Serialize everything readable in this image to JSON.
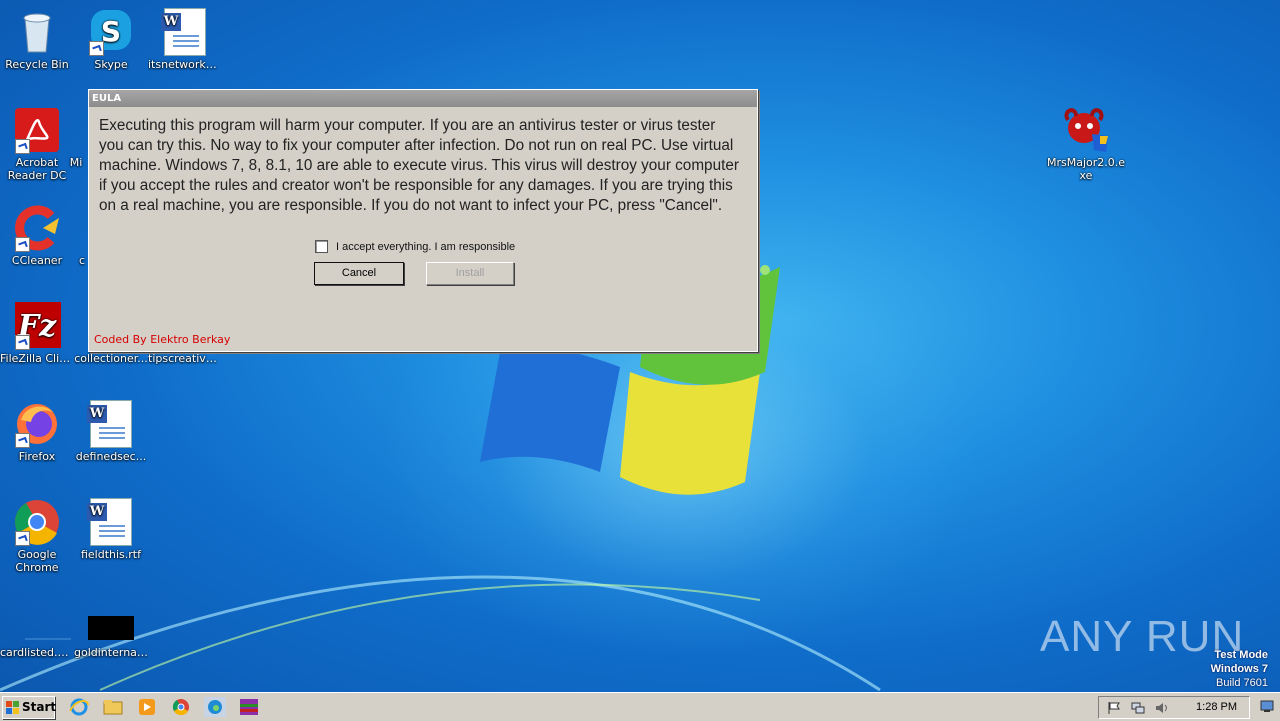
{
  "desktop": {
    "icons": [
      {
        "label": "Recycle Bin"
      },
      {
        "label": "Skype"
      },
      {
        "label": "itsnetworks.rtf"
      },
      {
        "label": "Acrobat Reader DC"
      },
      {
        "label": "Mi"
      },
      {
        "label": "CCleaner"
      },
      {
        "label": "c"
      },
      {
        "label": "FileZilla Client"
      },
      {
        "label": "collectioner..."
      },
      {
        "label": "tipscreative..."
      },
      {
        "label": "Firefox"
      },
      {
        "label": "definedsec..."
      },
      {
        "label": "Google Chrome"
      },
      {
        "label": "fieldthis.rtf"
      },
      {
        "label": "cardlisted.png"
      },
      {
        "label": "goldinternal..."
      },
      {
        "label": "MrsMajor2.0.exe"
      }
    ]
  },
  "dialog": {
    "title": "EULA",
    "message": "Executing this program will harm your computer. If you are an antivirus tester or virus tester you can try this. No way to fix your computer after infection. Do not run on real PC. Use virtual machine. Windows 7, 8, 8.1, 10 are able to execute virus. This virus will destroy your computer if you accept the rules and creator won't be responsible for any damages. If you are trying this on a real machine, you are responsible. If you do not want to infect your PC, press \"Cancel\".",
    "checkbox_label": "I accept everything. I am responsible",
    "checkbox_checked": false,
    "cancel_label": "Cancel",
    "install_label": "Install",
    "credit": "Coded By Elektro Berkay"
  },
  "taskbar": {
    "start_label": "Start",
    "apps": [
      "ie-icon",
      "explorer-icon",
      "media-player-icon",
      "chrome-icon",
      "edge-icon",
      "winrar-icon"
    ],
    "clock": "1:28 PM"
  },
  "watermark": {
    "line1": "Test Mode",
    "line2": "Windows 7",
    "line3": "Build 7601"
  },
  "brand": "ANY RUN"
}
